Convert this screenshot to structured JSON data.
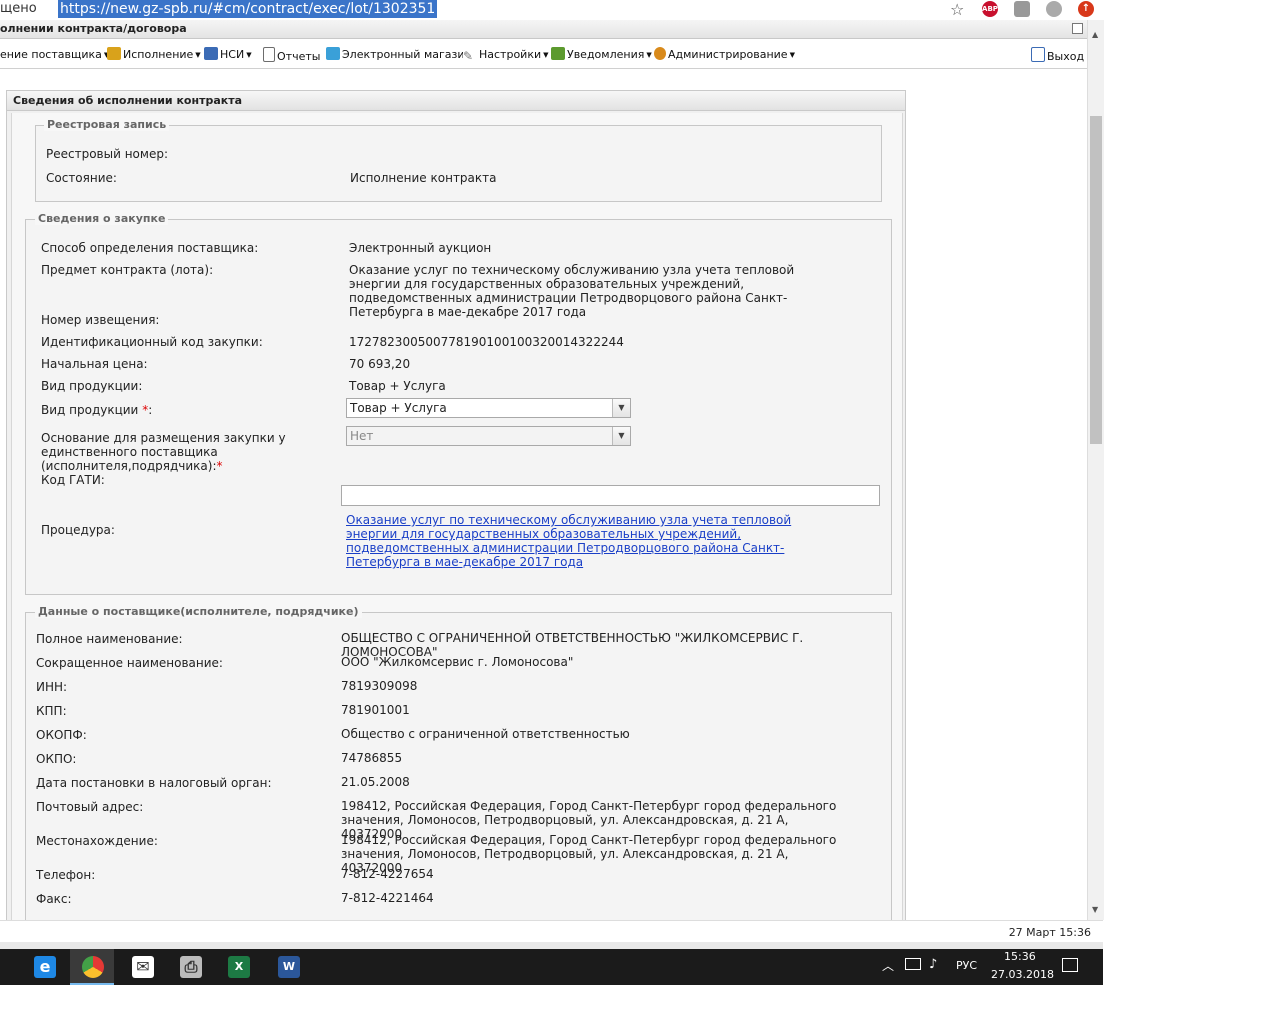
{
  "browser": {
    "secure_label": "щено",
    "url": "https://new.gz-spb.ru/#cm/contract/exec/lot/1302351",
    "extensions": [
      {
        "name": "adblock-icon",
        "label": "ABP",
        "color": "#c8102e"
      },
      {
        "name": "extension-gray-icon",
        "label": "",
        "color": "#999999"
      },
      {
        "name": "extension-tool-icon",
        "label": "",
        "color": "#aaaaaa"
      },
      {
        "name": "extension-red-icon",
        "label": "↑",
        "color": "#d8381a"
      }
    ]
  },
  "app": {
    "title": "олнении контракта/договора"
  },
  "menu": {
    "items": [
      {
        "label": "ение поставщика",
        "dropdown": true,
        "color": ""
      },
      {
        "label": "Исполнение",
        "dropdown": true,
        "color": "#d9a21b"
      },
      {
        "label": "НСИ",
        "dropdown": true,
        "color": "#3b6bb5"
      },
      {
        "label": "Отчеты",
        "dropdown": false,
        "color": "#6d6d6d"
      },
      {
        "label": "Электронный магазин",
        "dropdown": false,
        "color": "#3aa0d8"
      },
      {
        "label": "Настройки",
        "dropdown": true,
        "color": "#777777"
      },
      {
        "label": "Уведомления",
        "dropdown": true,
        "color": "#5c9a2e"
      },
      {
        "label": "Администрирование",
        "dropdown": true,
        "color": "#d98a1b"
      }
    ],
    "exit_label": "Выход"
  },
  "panel": {
    "title": "Сведения об исполнении контракта"
  },
  "registry": {
    "legend": "Реестровая запись",
    "number_label": "Реестровый номер:",
    "number_value": "",
    "state_label": "Состояние:",
    "state_value": "Исполнение контракта"
  },
  "purchase": {
    "legend": "Сведения о закупке",
    "method_label": "Способ определения поставщика:",
    "method_value": "Электронный аукцион",
    "subject_label": "Предмет контракта (лота):",
    "subject_value": "Оказание услуг по техническому обслуживанию узла учета тепловой энергии для государственных образовательных учреждений, подведомственных администрации Петродворцового района Санкт-Петербурга в мае-декабре 2017 года",
    "notice_label": "Номер извещения:",
    "notice_value": "",
    "ikz_label": "Идентификационный код закупки:",
    "ikz_value": "172782300500778190100100320014322244",
    "price_label": "Начальная цена:",
    "price_value": "70 693,20",
    "product_type_label": "Вид продукции:",
    "product_type_value": "Товар + Услуга",
    "product_type_select_label": "Вид продукции",
    "product_type_select_value": "Товар + Услуга",
    "single_supplier_label": "Основание для размещения закупки у единственного поставщика (исполнителя,подрядчика):",
    "single_supplier_value": "Нет",
    "gati_label": "Код ГАТИ:",
    "gati_value": "",
    "procedure_label": "Процедура:",
    "procedure_link": "Оказание услуг по техническому обслуживанию узла учета тепловой энергии для государственных образовательных учреждений, подведомственных администрации Петродворцового района Санкт-Петербурга в мае-декабре 2017 года",
    "required_mark": "*"
  },
  "supplier": {
    "legend": "Данные о поставщике(исполнителе, подрядчике)",
    "rows": [
      {
        "label": "Полное наименование:",
        "value": "ОБЩЕСТВО С ОГРАНИЧЕННОЙ ОТВЕТСТВЕННОСТЬЮ \"ЖИЛКОМСЕРВИС Г. ЛОМОНОСОВА\""
      },
      {
        "label": "Сокращенное наименование:",
        "value": "ООО \"Жилкомсервис г. Ломоносова\""
      },
      {
        "label": "ИНН:",
        "value": "7819309098"
      },
      {
        "label": "КПП:",
        "value": "781901001"
      },
      {
        "label": "ОКОПФ:",
        "value": "Общество с ограниченной ответственностью"
      },
      {
        "label": "ОКПО:",
        "value": "74786855"
      },
      {
        "label": "Дата постановки в налоговый орган:",
        "value": "21.05.2008"
      },
      {
        "label": "Почтовый адрес:",
        "value": "198412, Российская Федерация, Город Санкт-Петербург город федерального значения, Ломоносов, Петродворцовый, ул. Александровская, д. 21 А, 40372000"
      },
      {
        "label": "Местонахождение:",
        "value": "198412, Российская Федерация, Город Санкт-Петербург город федерального значения, Ломоносов, Петродворцовый, ул. Александровская, д. 21 А, 40372000"
      },
      {
        "label": "Телефон:",
        "value": "7-812-4227654"
      },
      {
        "label": "Факс:",
        "value": "7-812-4221464"
      }
    ]
  },
  "statusbar": {
    "datetime": "27 Март 15:36"
  },
  "taskbar": {
    "apps": [
      {
        "name": "internet-explorer-icon",
        "label": "e",
        "color": "#1e88e5"
      },
      {
        "name": "chrome-icon",
        "label": "",
        "color": "#e53935"
      },
      {
        "name": "mail-icon",
        "label": "✉",
        "color": "#333333"
      },
      {
        "name": "fax-icon",
        "label": "⎙",
        "color": "#666666"
      },
      {
        "name": "excel-icon",
        "label": "X",
        "color": "#1d7a44"
      },
      {
        "name": "word-icon",
        "label": "W",
        "color": "#2b579a"
      }
    ],
    "lang": "РУС",
    "time": "15:36",
    "date": "27.03.2018"
  }
}
